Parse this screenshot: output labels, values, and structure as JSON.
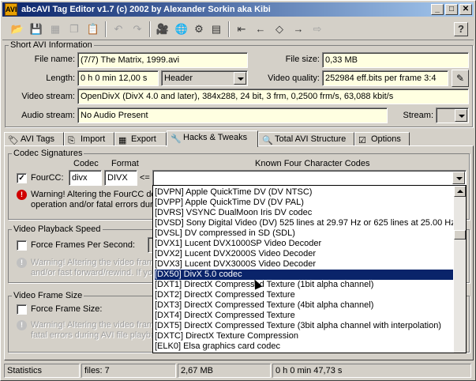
{
  "window": {
    "title": "abcAVI Tag Editor v1.7 (c) 2002 by Alexander Sorkin aka Kibi",
    "icon": "AVI",
    "controls": {
      "minimize": "_",
      "maximize": "□",
      "close": "✕"
    }
  },
  "toolbar": {
    "icons": [
      "open-folder-icon",
      "save-icon",
      "save-all-icon",
      "copy-icon",
      "paste-icon",
      "undo-icon",
      "redo-icon",
      "camera-icon",
      "globe-icon",
      "settings-icon",
      "table-icon",
      "first-icon",
      "previous-icon",
      "delete-icon",
      "next-icon",
      "last-icon"
    ],
    "help": "?"
  },
  "short_info": {
    "title": "Short AVI Information",
    "file_name_label": "File name:",
    "file_name": "(7/7) The Matrix, 1999.avi",
    "file_size_label": "File size:",
    "file_size": "0,33 MB",
    "length_label": "Length:",
    "length": "0 h 0 min 12,00 s",
    "length_mode": "Header",
    "video_quality_label": "Video quality:",
    "video_quality": "252984 eff.bits per frame 3:4",
    "video_stream_label": "Video stream:",
    "video_stream": "OpenDivX (DivX 4.0 and later), 384x288, 24 bit, 3 frm, 0,2500 frm/s, 63,088 kbit/s",
    "audio_stream_label": "Audio stream:",
    "audio_stream": "No Audio Present",
    "stream_label": "Stream:"
  },
  "tabs": [
    {
      "label": "AVI Tags",
      "icon": "tag-icon"
    },
    {
      "label": "Import",
      "icon": "import-icon"
    },
    {
      "label": "Export",
      "icon": "export-icon"
    },
    {
      "label": "Hacks & Tweaks",
      "icon": "hacks-icon",
      "active": true
    },
    {
      "label": "Total AVI Structure",
      "icon": "magnifier-icon"
    },
    {
      "label": "Options",
      "icon": "options-icon"
    }
  ],
  "codec": {
    "title": "Codec Signatures",
    "codec_header": "Codec",
    "format_header": "Format",
    "known_header": "Known Four Character Codes",
    "fourcc_label": "FourCC:",
    "fourcc_checked": true,
    "codec_value": "divx",
    "format_value": "DIVX",
    "arrow": "<=",
    "warning1": "Warning! Altering the FourCC dec",
    "warning2": "operation and/or fatal errors durin"
  },
  "playback": {
    "title": "Video Playback Speed",
    "force_label": "Force Frames Per Second:",
    "warning1": "Warning! Altering the video frame",
    "warning2": "and/or fast forward/rewind. If yo"
  },
  "framesize": {
    "title": "Video Frame Size",
    "force_label": "Force Frame Size:",
    "warning1": "Warning! Altering the video frame",
    "warning2": "fatal errors during AVI file playbac"
  },
  "dropdown": {
    "items": [
      "[DVPN] Apple QuickTime DV (DV NTSC)",
      "[DVPP] Apple QuickTime DV (DV PAL)",
      "[DVRS] VSYNC DualMoon Iris DV codec",
      "[DVSD] Sony Digital Video (DV) 525 lines at 29.97 Hz or 625 lines at 25.00 Hz",
      "[DVSL] DV compressed in SD (SDL)",
      "[DVX1] Lucent DVX1000SP Video Decoder",
      "[DVX2] Lucent DVX2000S Video Decoder",
      "[DVX3] Lucent DVX3000S Video Decoder",
      "[DX50] DivX 5.0 codec",
      "[DXT1] DirectX Compressed Texture (1bit alpha channel)",
      "[DXT2] DirectX Compressed Texture",
      "[DXT3] DirectX Compressed Texture (4bit alpha channel)",
      "[DXT4] DirectX Compressed Texture",
      "[DXT5] DirectX Compressed Texture (3bit alpha channel with interpolation)",
      "[DXTC] DirectX Texture Compression",
      "[ELK0] Elsa graphics card codec"
    ],
    "selected_index": 8
  },
  "statusbar": {
    "label": "Statistics",
    "files": "files: 7",
    "size": "2,67 MB",
    "duration": "0 h 0 min 47,73 s"
  }
}
